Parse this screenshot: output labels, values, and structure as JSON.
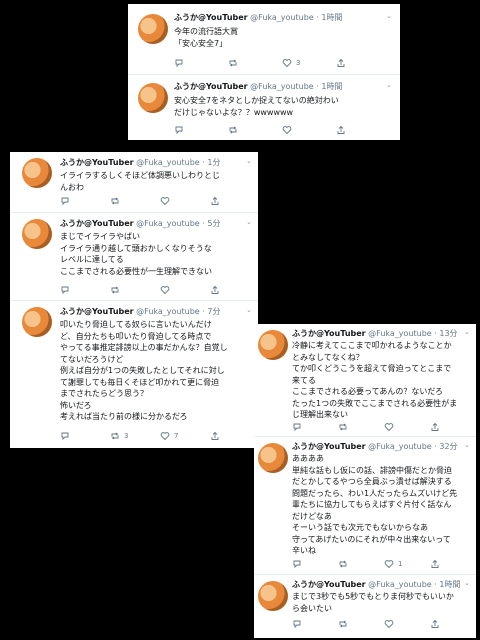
{
  "author": {
    "name": "ふうか@YouTuber",
    "handle": "@Fuka_youtube"
  },
  "icons": {
    "reply": "reply-icon",
    "retweet": "retweet-icon",
    "like": "heart-icon",
    "share": "share-icon",
    "more": "chevron-down-icon"
  },
  "card1": {
    "tweets": [
      {
        "time": "· 1時間",
        "lines": [
          "今年の流行語大賞",
          "「安心安全7」"
        ],
        "retweets": "",
        "likes": "3"
      },
      {
        "time": "· 1時間",
        "lines": [
          "安心安全7をネタとしか捉えてないの絶対わい",
          "だけじゃないよな？？wwwwww"
        ],
        "retweets": "",
        "likes": ""
      }
    ]
  },
  "card2": {
    "tweets": [
      {
        "time": "· 1分",
        "lines": [
          "イライラするしくそほど体調悪いしわりとじ",
          "んおわ"
        ],
        "retweets": "",
        "likes": ""
      },
      {
        "time": "· 5分",
        "lines": [
          "まじでイライラやばい",
          "イライラ通り越して頭おかしくなりそうな",
          "レベルに達してる",
          "ここまでされる必要性が一生理解できない"
        ],
        "retweets": "",
        "likes": ""
      },
      {
        "time": "· 7分",
        "lines": [
          "叩いたり脅迫してる奴らに言いたいんだけ",
          "ど、自分たちも叩いたり脅迫してる時点で",
          "やってる事推定誹謗以上の事だかんな？自覚し",
          "てないだろうけど",
          "例えば自分が1つの失敗したとしてそれに対し",
          "て謝罪しても毎日くそほど叩かれて更に脅迫",
          "までされたらどう思う？",
          "怖いだろ",
          "考えれば当たり前の様に分かるだろ"
        ],
        "retweets": "3",
        "likes": "7"
      }
    ]
  },
  "card3": {
    "tweets": [
      {
        "time": "· 13分",
        "lines": [
          "冷静に考えてここまで叩かれるようなことか",
          "とみなしてなくね？",
          "てか叩くどうこうを超えて脅迫ってとこまで",
          "来てる",
          "ここまでされる必要ってあんの？ないだろ",
          "たった1つの失敗でここまでされる必要性がま",
          "じ理解出来ない"
        ],
        "retweets": "",
        "likes": ""
      },
      {
        "time": "· 32分",
        "lines": [
          "ああああ",
          "単純な話もし仮にの話、誹謗中傷だとか脅迫",
          "だとかしてるやつら全員ぶっ潰せば解決する",
          "問題だったら、わい1人だったらムズいけど先",
          "輩たちに協力してもらえばすぐ片付く話なん",
          "だけどなあ",
          "そーいう話でも次元でもないからなあ",
          "守ってあげたいのにそれが中々出来ないって",
          "辛いね"
        ],
        "retweets": "",
        "likes": "1"
      },
      {
        "time": "· 1時間",
        "lines": [
          "まじで3秒でも5秒でもとりま何秒でもいいか",
          "ら会いたい"
        ],
        "retweets": "",
        "likes": ""
      }
    ]
  }
}
